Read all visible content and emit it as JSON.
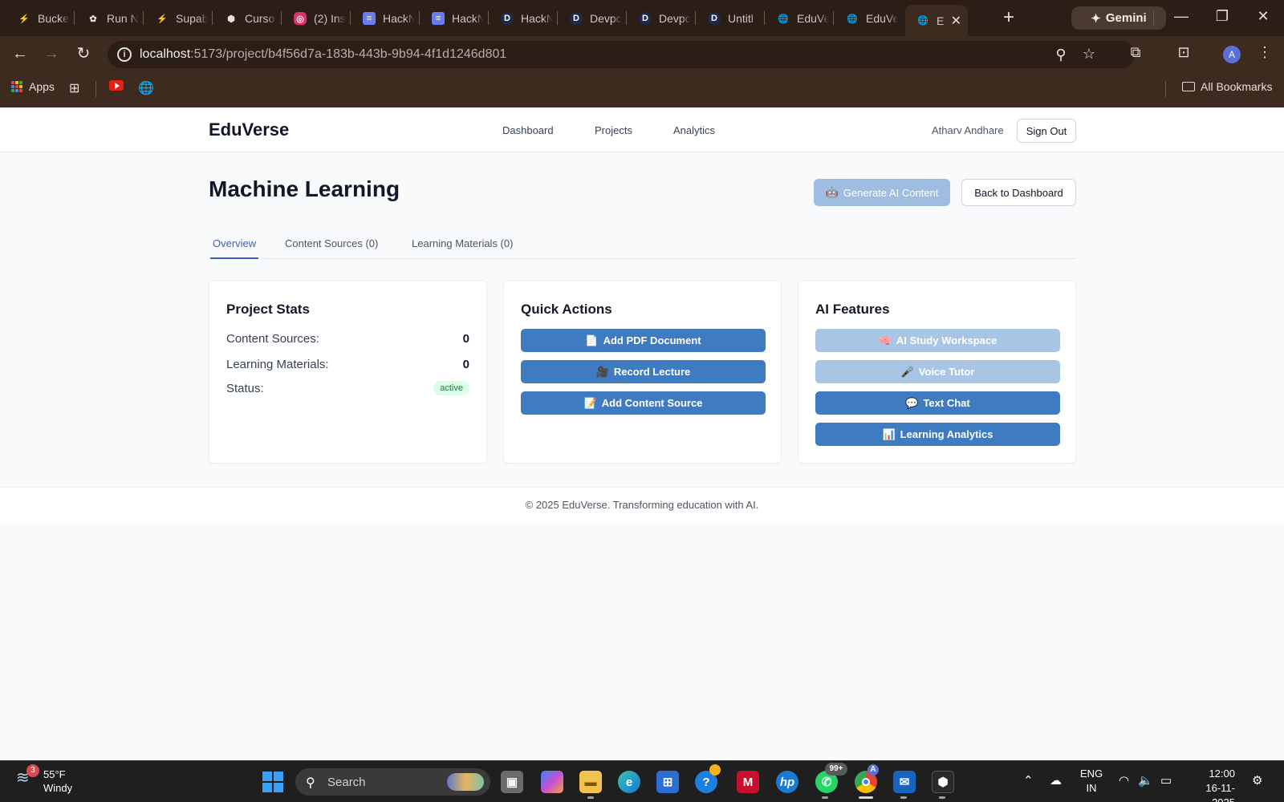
{
  "browser": {
    "tabs": [
      {
        "title": "Bucke",
        "icon": "bolt-icon",
        "color": "#3ecf8e"
      },
      {
        "title": "Run N",
        "icon": "openai-icon",
        "color": "#e8e0da"
      },
      {
        "title": "Supab",
        "icon": "bolt-icon",
        "color": "#3ecf8e"
      },
      {
        "title": "Curso",
        "icon": "cube-icon",
        "color": "#e8e0da"
      },
      {
        "title": "(2) Ins",
        "icon": "instagram-icon",
        "color": "#e1306c"
      },
      {
        "title": "HackN",
        "icon": "docs-icon",
        "color": "#6a7cf0"
      },
      {
        "title": "HackN",
        "icon": "docs-icon",
        "color": "#6a7cf0"
      },
      {
        "title": "HackN",
        "icon": "d-icon",
        "color": "#1e2a4a"
      },
      {
        "title": "Devpc",
        "icon": "d-icon",
        "color": "#1e2a4a"
      },
      {
        "title": "Devpc",
        "icon": "d-icon",
        "color": "#1e2a4a"
      },
      {
        "title": "Untitl",
        "icon": "d-icon",
        "color": "#1e2a4a"
      },
      {
        "title": "EduVe",
        "icon": "globe-icon",
        "color": "#cfc6bf"
      },
      {
        "title": "EduVe",
        "icon": "globe-icon",
        "color": "#cfc6bf"
      },
      {
        "title": "E",
        "icon": "globe-icon",
        "color": "#cfc6bf"
      }
    ],
    "gemini_label": "Gemini",
    "url_host": "localhost",
    "url_path": ":5173/project/b4f56d7a-183b-443b-9b94-4f1d1246d801",
    "profile_initial": "A",
    "bookmarks": {
      "apps_label": "Apps",
      "all_bookmarks_label": "All Bookmarks"
    }
  },
  "app": {
    "logo": "EduVerse",
    "nav": [
      "Dashboard",
      "Projects",
      "Analytics"
    ],
    "user_name": "Atharv Andhare",
    "sign_out_label": "Sign Out",
    "project_title": "Machine Learning",
    "generate_label": "Generate AI Content",
    "generate_emoji": "🤖",
    "back_label": "Back to Dashboard",
    "tabs": [
      "Overview",
      "Content Sources (0)",
      "Learning Materials (0)"
    ],
    "stats": {
      "title": "Project Stats",
      "rows": [
        {
          "label": "Content Sources:",
          "value": "0"
        },
        {
          "label": "Learning Materials:",
          "value": "0"
        },
        {
          "label": "Status:",
          "value": "active"
        }
      ]
    },
    "quick_actions": {
      "title": "Quick Actions",
      "buttons": [
        {
          "emoji": "📄",
          "label": "Add PDF Document"
        },
        {
          "emoji": "🎥",
          "label": "Record Lecture"
        },
        {
          "emoji": "📝",
          "label": "Add Content Source"
        }
      ]
    },
    "ai_features": {
      "title": "AI Features",
      "buttons": [
        {
          "emoji": "🧠",
          "label": "AI Study Workspace",
          "disabled": true
        },
        {
          "emoji": "🎤",
          "label": "Voice Tutor",
          "disabled": true
        },
        {
          "emoji": "💬",
          "label": "Text Chat",
          "disabled": false
        },
        {
          "emoji": "📊",
          "label": "Learning Analytics",
          "disabled": false
        }
      ]
    },
    "footer": "© 2025 EduVerse. Transforming education with AI."
  },
  "taskbar": {
    "weather_badge": "3",
    "temperature": "55°F",
    "condition": "Windy",
    "search_placeholder": "Search",
    "whatsapp_badge": "99+",
    "chrome_profile": "A",
    "lang_line1": "ENG",
    "lang_line2": "IN",
    "time": "12:00",
    "date": "16-11-2025"
  },
  "colors": {
    "accent": "#3b5fc4",
    "button_primary": "#3f7bc1",
    "button_disabled": "#a9c5e6",
    "status_active_bg": "#dcfce7",
    "status_active_fg": "#15803d"
  }
}
